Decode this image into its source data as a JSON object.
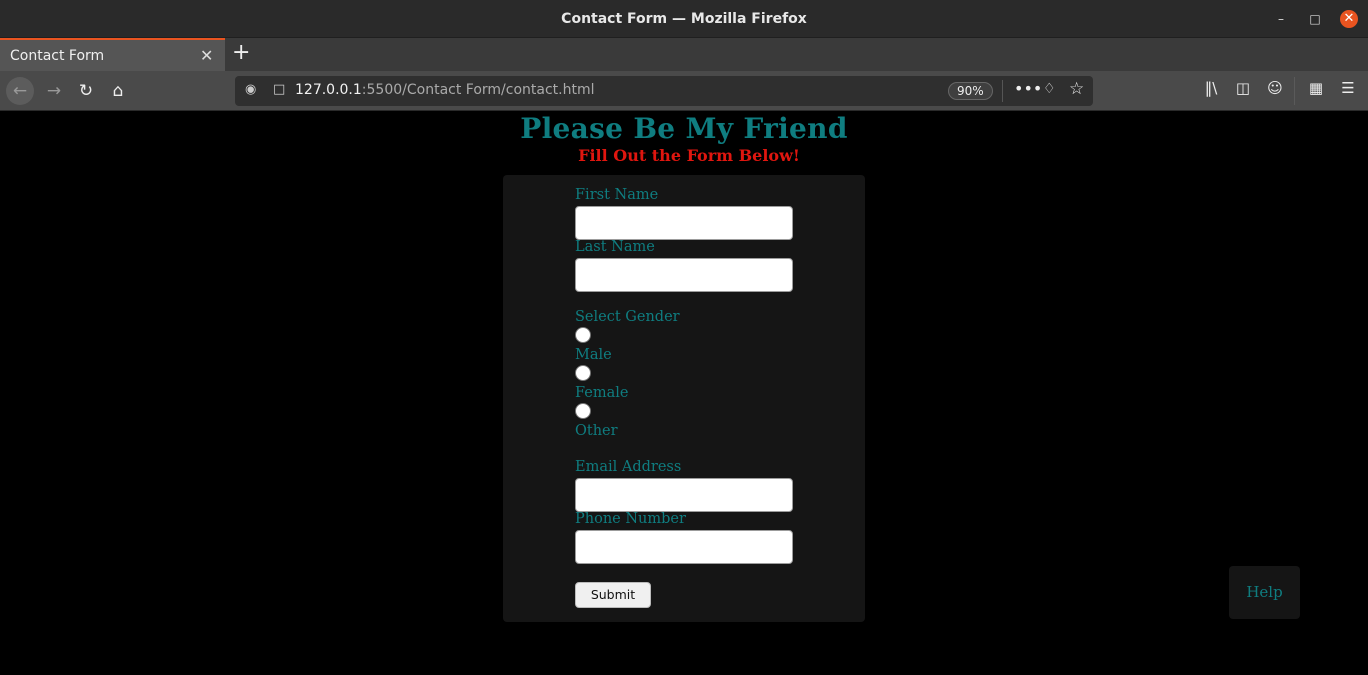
{
  "window": {
    "title": "Contact Form — Mozilla Firefox",
    "minimize_icon": "minimize-icon",
    "maximize_icon": "maximize-icon",
    "close_icon": "close-icon"
  },
  "tabs": [
    {
      "label": "Contact Form",
      "active": true
    }
  ],
  "navbar": {
    "url_host": "127.0.0.1",
    "url_rest": ":5500/Contact Form/contact.html",
    "zoom": "90%"
  },
  "page": {
    "heading": "Please Be My Friend",
    "subheading": "Fill Out the Form Below!",
    "form": {
      "first_name_label": "First Name",
      "last_name_label": "Last Name",
      "gender_label": "Select Gender",
      "gender_options": [
        "Male",
        "Female",
        "Other"
      ],
      "email_label": "Email Address",
      "phone_label": "Phone Number",
      "submit_label": "Submit"
    },
    "help_label": "Help"
  },
  "colors": {
    "heading": "#0f7d80",
    "subheading": "#e0160f",
    "page_background": "#000000",
    "card_background": "#151515",
    "tab_accent": "#e95420"
  }
}
